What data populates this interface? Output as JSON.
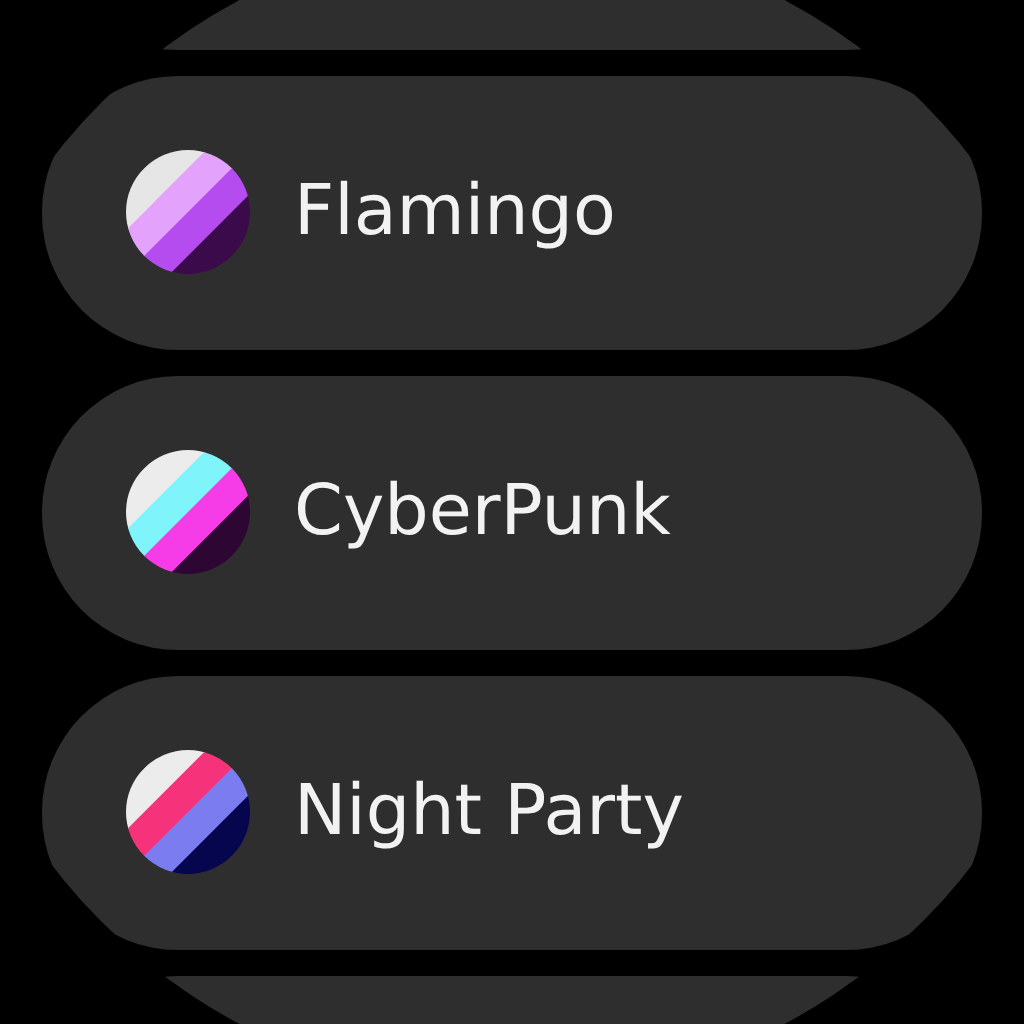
{
  "themes": [
    {
      "label": "Flamingo",
      "stripes": [
        {
          "color": "#e6e6e6"
        },
        {
          "color": "#e3a2fb"
        },
        {
          "color": "#b44cf0"
        },
        {
          "color": "#3a0a4a"
        }
      ]
    },
    {
      "label": "CyberPunk",
      "stripes": [
        {
          "color": "#ececec"
        },
        {
          "color": "#7ff4fb"
        },
        {
          "color": "#f53ce6"
        },
        {
          "color": "#2e0633"
        }
      ]
    },
    {
      "label": "Night Party",
      "stripes": [
        {
          "color": "#ececec"
        },
        {
          "color": "#f5327a"
        },
        {
          "color": "#7b7cf0"
        },
        {
          "color": "#06064e"
        }
      ]
    }
  ]
}
